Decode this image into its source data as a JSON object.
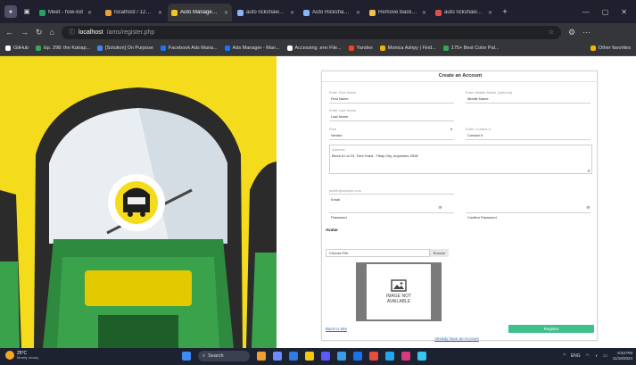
{
  "tabs": [
    {
      "title": "Meet - hsw-kxt",
      "color": "#21a464",
      "active": false
    },
    {
      "title": "localhost / 127.0.0.1",
      "color": "#e8a23a",
      "active": false
    },
    {
      "title": "Auto Management S",
      "color": "#f3c624",
      "active": true
    },
    {
      "title": "auto rickshaw vendor",
      "color": "#8ab4f8",
      "active": false
    },
    {
      "title": "Auto Rickshaw Clip A",
      "color": "#8ab4f8",
      "active": false
    },
    {
      "title": "Remove Background",
      "color": "#f5c04a",
      "active": false
    },
    {
      "title": "auto rickshaw front",
      "color": "#e44d4d",
      "active": false
    }
  ],
  "address": {
    "host": "localhost",
    "path": "/ams/register.php"
  },
  "bookmarks": [
    {
      "label": "GitHub",
      "color": "#ffffff"
    },
    {
      "label": "Ep. 298: the Katrap...",
      "color": "#34a853"
    },
    {
      "label": "[Solution] On Purpose",
      "color": "#4285f4"
    },
    {
      "label": "Facebook Ads Mana...",
      "color": "#1877f2"
    },
    {
      "label": "Ads Manager - Man...",
      "color": "#1877f2"
    },
    {
      "label": "Accessing .env File...",
      "color": "#ffffff"
    },
    {
      "label": "Yandex",
      "color": "#fc3f1d"
    },
    {
      "label": "Monica Ashpy | Find...",
      "color": "#f4b400"
    },
    {
      "label": "175+ Best Color Pal...",
      "color": "#34a853"
    }
  ],
  "bookmarks_other": "Other favorites",
  "form": {
    "title": "Create an Account",
    "first_name_label": "Enter First Name",
    "first_name": "First Name",
    "middle_name_label": "Enter Middle Name (optional)",
    "middle_name": "Middle Name",
    "last_name_label": "Enter Last Name",
    "last_name": "Last Name",
    "role_label": "Role",
    "role_value": "Vendor",
    "contact_label": "Enter Contact #",
    "contact_value": "Contact #",
    "address_label": "Address",
    "address_value": "Block 8 Lot 23, Fare Subd., Tibay City, Anywhere 2006",
    "email_placeholder": "jsmith@sample.com",
    "email_label": "Email",
    "password_label": "Password",
    "confirm_password_label": "Confirm Password",
    "avatar_heading": "Avatar",
    "choose_file": "Choose File",
    "browse": "Browse",
    "image_caption_1": "IMAGE NOT",
    "image_caption_2": "AVAILABLE",
    "back_link": "Back to Site",
    "register_button": "Register",
    "login_link": "Already have an Account"
  },
  "taskbar": {
    "temperature": "25°C",
    "weather": "Mostly cloudy",
    "search": "Search",
    "lang": "ENG",
    "time": "8:53 PM",
    "date": "11/18/2024"
  },
  "colors": {
    "hero_yellow": "#f4dc1d",
    "rickshaw_green": "#2d8a3e",
    "accent": "#3fbf8c"
  }
}
